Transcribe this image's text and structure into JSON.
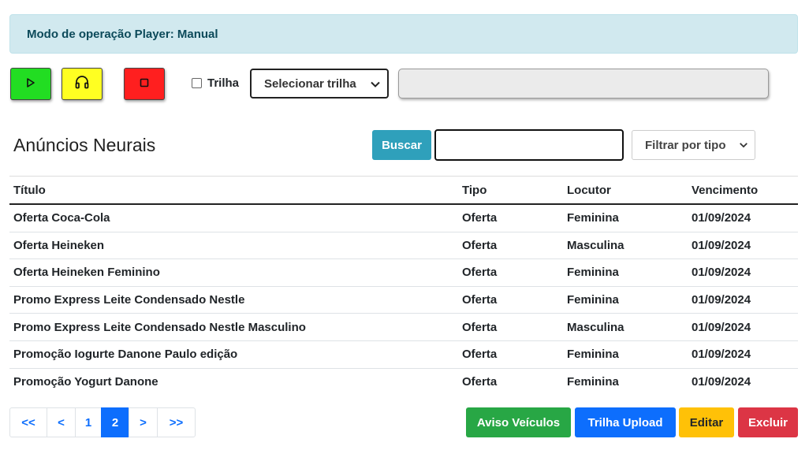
{
  "alert": {
    "text": "Modo de operação Player: Manual"
  },
  "controls": {
    "play_icon": "play-icon",
    "listen_icon": "headphones-icon",
    "stop_icon": "stop-icon",
    "colors": {
      "play": "#22dd22",
      "listen": "#ffff22",
      "stop": "#ff1f1f"
    }
  },
  "trilha": {
    "checkbox_label": "Trilha",
    "checked": false,
    "select_value": "Selecionar trilha"
  },
  "section": {
    "title": "Anúncios Neurais"
  },
  "search": {
    "button_label": "Buscar",
    "input_value": "",
    "filter_value": "Filtrar por tipo"
  },
  "table": {
    "headers": [
      "Título",
      "Tipo",
      "Locutor",
      "Vencimento"
    ],
    "rows": [
      [
        "Oferta Coca-Cola",
        "Oferta",
        "Feminina",
        "01/09/2024"
      ],
      [
        "Oferta Heineken",
        "Oferta",
        "Masculina",
        "01/09/2024"
      ],
      [
        "Oferta Heineken Feminino",
        "Oferta",
        "Feminina",
        "01/09/2024"
      ],
      [
        "Promo Express Leite Condensado Nestle",
        "Oferta",
        "Feminina",
        "01/09/2024"
      ],
      [
        "Promo Express Leite Condensado Nestle Masculino",
        "Oferta",
        "Masculina",
        "01/09/2024"
      ],
      [
        "Promoção Iogurte Danone Paulo edição",
        "Oferta",
        "Feminina",
        "01/09/2024"
      ],
      [
        "Promoção Yogurt Danone",
        "Oferta",
        "Feminina",
        "01/09/2024"
      ]
    ]
  },
  "pagination": {
    "items": [
      "<<",
      "<",
      "1",
      "2",
      ">",
      ">>"
    ],
    "active": "2"
  },
  "actions": {
    "aviso": "Aviso Veículos",
    "upload": "Trilha Upload",
    "editar": "Editar",
    "excluir": "Excluir",
    "colors": {
      "aviso": "#28a745",
      "upload": "#0d6efd",
      "editar": "#ffc107",
      "excluir": "#dc3545"
    }
  }
}
